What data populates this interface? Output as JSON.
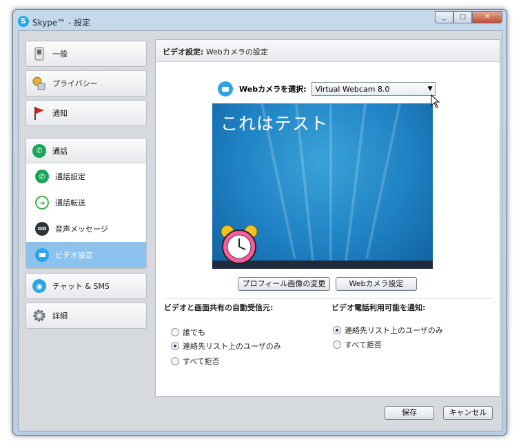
{
  "window": {
    "title": "Skype™ - 設定",
    "minimize": "_",
    "maximize": "□",
    "close": "✕"
  },
  "sidebar": {
    "items": [
      {
        "label": "一般",
        "icon": "switch-icon"
      },
      {
        "label": "プライバシー",
        "icon": "key-lock-icon"
      },
      {
        "label": "通知",
        "icon": "red-flag-icon"
      }
    ],
    "call_group": {
      "label": "通話",
      "sub_items": [
        {
          "label": "通話設定",
          "icon": "phone-icon"
        },
        {
          "label": "通話転送",
          "icon": "forward-icon"
        },
        {
          "label": "音声メッセージ",
          "icon": "voicemail-icon"
        },
        {
          "label": "ビデオ設定",
          "icon": "video-icon",
          "active": true
        }
      ]
    },
    "bottom_items": [
      {
        "label": "チャット & SMS",
        "icon": "chat-icon"
      },
      {
        "label": "詳細",
        "icon": "gear-icon"
      }
    ]
  },
  "panel": {
    "heading_bold": "ビデオ設定:",
    "heading_rest": " Webカメラの設定",
    "camera_label": "Webカメラを選択:",
    "camera_value": "Virtual Webcam 8.0",
    "preview_text": "これはテスト",
    "profile_button": "プロフィール画像の変更",
    "webcam_button": "Webカメラ設定",
    "auto_receive_title": "ビデオと画面共有の自動受信元:",
    "auto_receive_options": [
      "誰でも",
      "連絡先リスト上のユーザのみ",
      "すべて拒否"
    ],
    "auto_receive_selected": 1,
    "notify_title": "ビデオ電話利用可能を通知:",
    "notify_options": [
      "連絡先リスト上のユーザのみ",
      "すべて拒否"
    ],
    "notify_selected": 0
  },
  "footer": {
    "save": "保存",
    "cancel": "キャンセル"
  },
  "colors": {
    "skype_blue": "#1fa8e8",
    "active_item": "#8cc3ee",
    "preview_bg": "#1e82c4"
  }
}
